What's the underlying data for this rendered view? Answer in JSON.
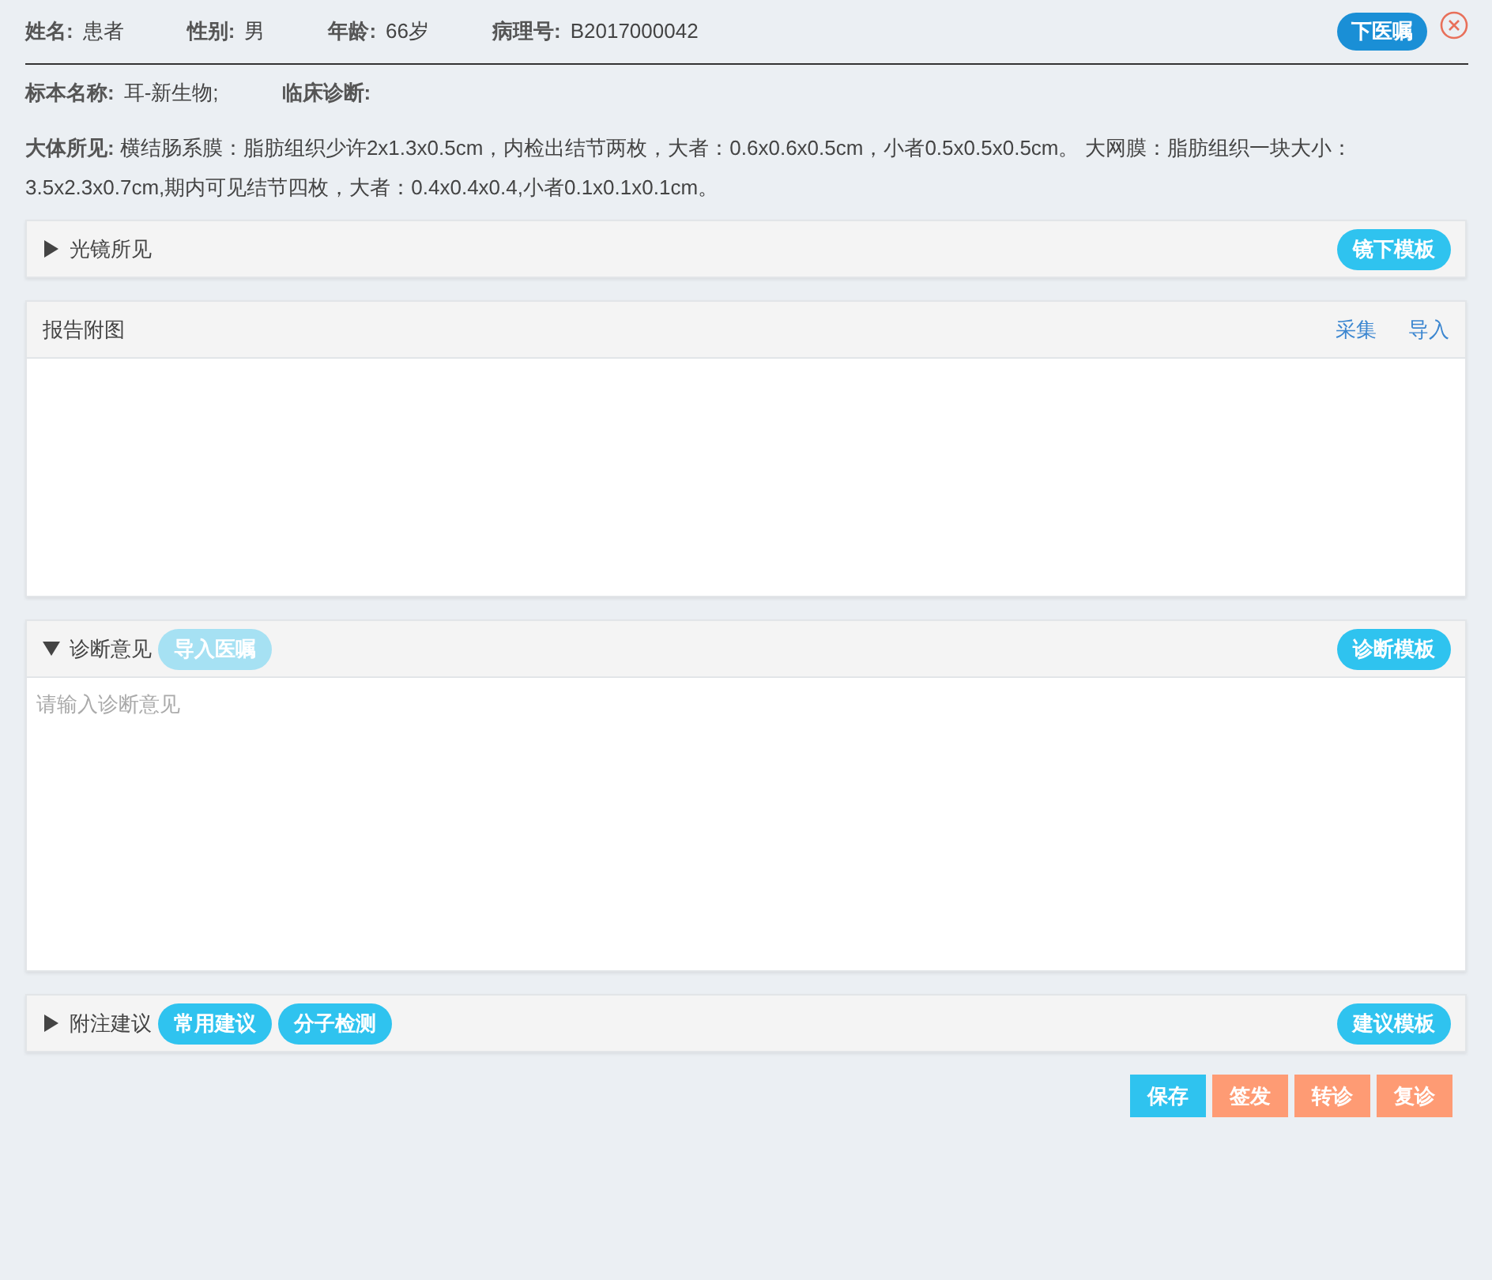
{
  "patient": {
    "fields": [
      {
        "label": "姓名:",
        "value": "患者"
      },
      {
        "label": "性别:",
        "value": "男"
      },
      {
        "label": "年龄:",
        "value": "66岁"
      },
      {
        "label": "病理号:",
        "value": "B2017000042"
      }
    ],
    "order_button": "下医嘱"
  },
  "specimen": {
    "fields": [
      {
        "label": "标本名称:",
        "value": "耳-新生物;"
      },
      {
        "label": "临床诊断:"
      }
    ]
  },
  "gross": {
    "text": "**大体所见:** 横结肠系膜：脂肪组织少许2x1.3x0.5cm，内检出结节两枚，大者：0.6x0.6x0.5cm，小者0.5x0.5x0.5cm。 大网膜：脂肪组织一块大小：3.5x2.3x0.7cm,期内可见结节四枚，大者：0.4x0.4x0.4,小者0.1x0.1x0.1cm。"
  },
  "panels": [
    {
      "kind": "collapsible",
      "title": "光镜所见",
      "expanded": false,
      "template_button": "镜下模板"
    },
    {
      "kind": "attachment",
      "title": "报告附图",
      "links": [
        "采集",
        "导入"
      ]
    },
    {
      "kind": "collapsible",
      "title": "诊断意见",
      "expanded": true,
      "buttons": [
        {
          "label": "导入医嘱",
          "disabled": true
        }
      ],
      "template_button": "诊断模板",
      "placeholder": "请输入诊断意见"
    },
    {
      "kind": "collapsible",
      "title": "附注建议",
      "expanded": false,
      "buttons": [
        {
          "label": "常用建议",
          "disabled": false
        },
        {
          "label": "分子检测",
          "disabled": false
        }
      ],
      "template_button": "建议模板"
    }
  ],
  "actions": [
    {
      "label": "保存",
      "kind": "primary"
    },
    {
      "label": "签发",
      "kind": "warning"
    },
    {
      "label": "转诊",
      "kind": "warning"
    },
    {
      "label": "复诊",
      "kind": "warning"
    }
  ]
}
